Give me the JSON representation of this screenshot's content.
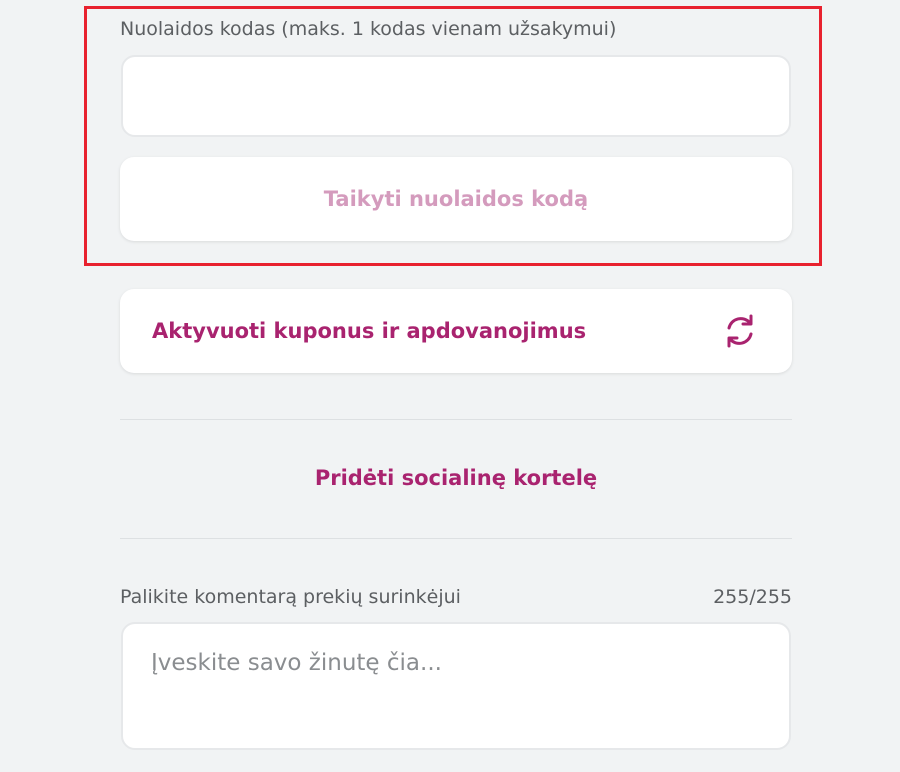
{
  "discount": {
    "label": "Nuolaidos kodas (maks. 1 kodas vienam užsakymui)",
    "input_value": "",
    "apply_button_label": "Taikyti nuolaidos kodą"
  },
  "coupons": {
    "button_label": "Aktyvuoti kuponus ir apdovanojimus",
    "icon": "refresh-icon"
  },
  "social_card": {
    "link_label": "Pridėti socialinę kortelę"
  },
  "comment": {
    "label": "Palikite komentarą prekių surinkėjui",
    "counter": "255/255",
    "placeholder": "Įveskite savo žinutę čia..."
  },
  "colors": {
    "accent": "#a9236f",
    "accent_muted": "#d49bbd",
    "highlight": "#e8212e",
    "background": "#f1f3f4"
  }
}
